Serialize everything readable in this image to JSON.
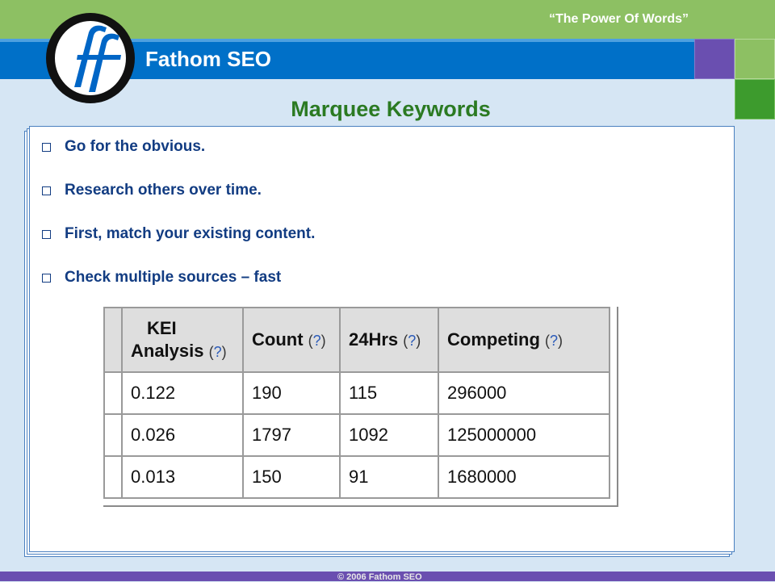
{
  "header": {
    "brand": "Fathom SEO",
    "tagline": "“The Power Of Words”",
    "logo_icon": "fathom-ff-logo",
    "colors": {
      "green": "#8dc063",
      "blue": "#0070c8",
      "purple": "#6a4fb0",
      "dark_green": "#3d9b2d"
    }
  },
  "slide": {
    "title": "Marquee Keywords",
    "bullets": [
      "Go for the obvious.",
      "Research others over time.",
      "First, match your existing content.",
      "Check multiple sources – fast"
    ]
  },
  "kei_table": {
    "headers": {
      "kei_line1": "KEI",
      "kei_line2": "Analysis",
      "count": "Count",
      "hrs": "24Hrs",
      "competing": "Competing",
      "help": "?"
    },
    "rows": [
      {
        "kei": "0.122",
        "count": "190",
        "hrs": "115",
        "competing": "296000"
      },
      {
        "kei": "0.026",
        "count": "1797",
        "hrs": "1092",
        "competing": "125000000"
      },
      {
        "kei": "0.013",
        "count": "150",
        "hrs": "91",
        "competing": "1680000"
      }
    ]
  },
  "footer": {
    "copyright": "© 2006 Fathom SEO"
  }
}
